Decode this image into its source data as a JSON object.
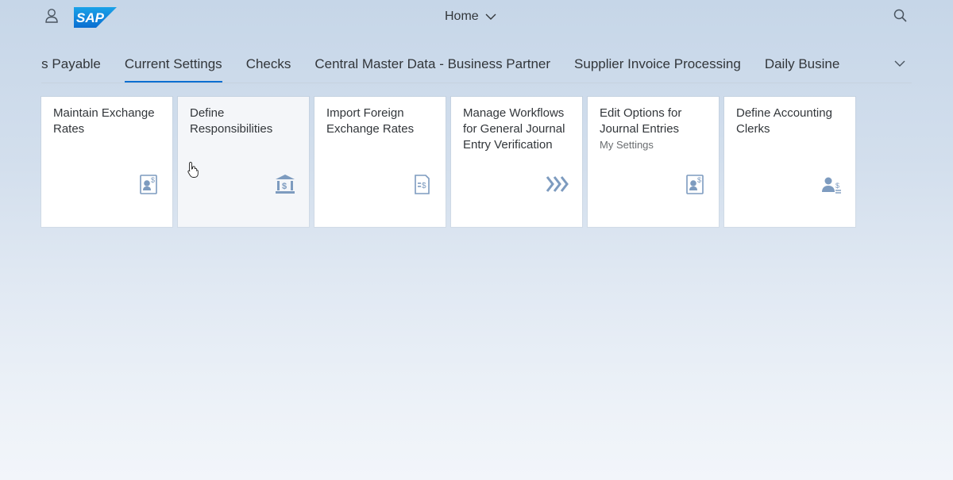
{
  "shell": {
    "logo_text": "SAP",
    "home_label": "Home",
    "user_icon": "user-icon",
    "search_icon": "search-icon",
    "brand_color": "#0a6ed1"
  },
  "tabs": [
    {
      "label": "nts Payable",
      "selected": false
    },
    {
      "label": "Current Settings",
      "selected": true
    },
    {
      "label": "Checks",
      "selected": false
    },
    {
      "label": "Central Master Data - Business Partner",
      "selected": false
    },
    {
      "label": "Supplier Invoice Processing",
      "selected": false
    },
    {
      "label": "Daily Busine",
      "selected": false
    }
  ],
  "tiles": [
    {
      "title_line1": "Maintain Exchange",
      "title_line2": "Rates",
      "title_line3": "",
      "subtitle": "",
      "icon": "customer-financial-fact-sheet-icon"
    },
    {
      "title_line1": "Define",
      "title_line2": "Responsibilities",
      "title_line3": "",
      "subtitle": "",
      "icon": "bank-icon"
    },
    {
      "title_line1": "Import Foreign",
      "title_line2": "Exchange Rates",
      "title_line3": "",
      "subtitle": "",
      "icon": "expense-report-icon"
    },
    {
      "title_line1": "Manage Workflows",
      "title_line2": "for General Journal",
      "title_line3": "Entry Verification",
      "subtitle": "",
      "icon": "process-chevrons-icon"
    },
    {
      "title_line1": "Edit Options for",
      "title_line2": "Journal Entries",
      "title_line3": "",
      "subtitle": "My Settings",
      "icon": "customer-financial-fact-sheet-icon"
    },
    {
      "title_line1": "Define Accounting",
      "title_line2": "Clerks",
      "title_line3": "",
      "subtitle": "",
      "icon": "accounting-clerk-icon"
    }
  ],
  "colors": {
    "icon": "#7d9bbf",
    "tab_underline": "#0a6ed1",
    "text": "#32363a"
  }
}
